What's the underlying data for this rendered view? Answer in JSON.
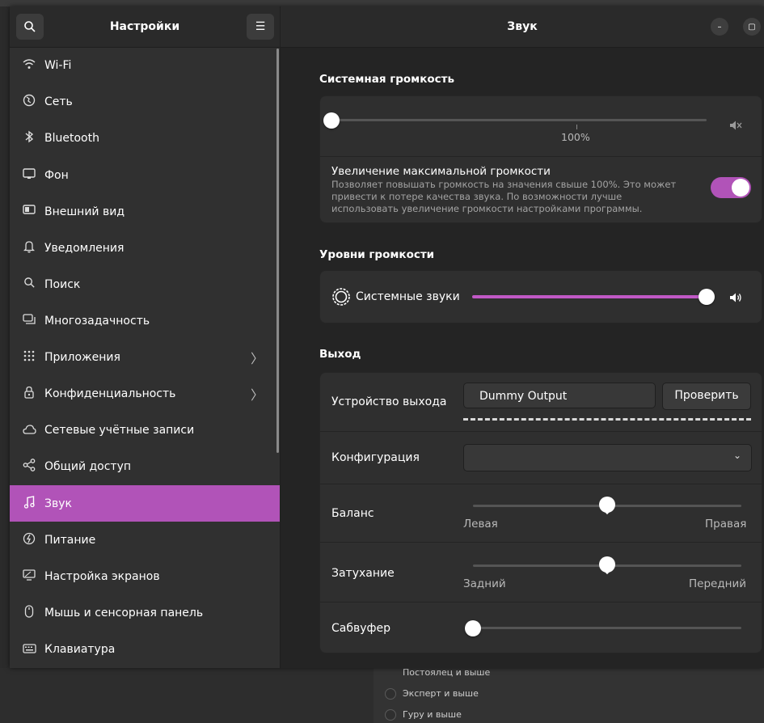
{
  "sidebar": {
    "title": "Настройки",
    "items": [
      {
        "label": "Wi-Fi",
        "icon": "wifi-icon",
        "chevron": false,
        "active": false
      },
      {
        "label": "Сеть",
        "icon": "network-globe-icon",
        "chevron": false,
        "active": false
      },
      {
        "label": "Bluetooth",
        "icon": "bluetooth-icon",
        "chevron": false,
        "active": false
      },
      {
        "label": "Фон",
        "icon": "background-icon",
        "chevron": false,
        "active": false
      },
      {
        "label": "Внешний вид",
        "icon": "appearance-icon",
        "chevron": false,
        "active": false
      },
      {
        "label": "Уведомления",
        "icon": "bell-icon",
        "chevron": false,
        "active": false
      },
      {
        "label": "Поиск",
        "icon": "search-icon",
        "chevron": false,
        "active": false
      },
      {
        "label": "Многозадачность",
        "icon": "multitasking-icon",
        "chevron": false,
        "active": false
      },
      {
        "label": "Приложения",
        "icon": "apps-grid-icon",
        "chevron": true,
        "active": false
      },
      {
        "label": "Конфиденциальность",
        "icon": "lock-icon",
        "chevron": true,
        "active": false
      },
      {
        "label": "Сетевые учётные записи",
        "icon": "cloud-icon",
        "chevron": false,
        "active": false
      },
      {
        "label": "Общий доступ",
        "icon": "share-icon",
        "chevron": false,
        "active": false
      },
      {
        "label": "Звук",
        "icon": "music-note-icon",
        "chevron": false,
        "active": true
      },
      {
        "label": "Питание",
        "icon": "power-icon",
        "chevron": false,
        "active": false
      },
      {
        "label": "Настройка экранов",
        "icon": "display-icon",
        "chevron": false,
        "active": false
      },
      {
        "label": "Мышь и сенсорная панель",
        "icon": "mouse-icon",
        "chevron": false,
        "active": false
      },
      {
        "label": "Клавиатура",
        "icon": "keyboard-icon",
        "chevron": false,
        "active": false
      }
    ]
  },
  "main": {
    "title": "Звук",
    "system_volume": {
      "heading": "Системная громкость",
      "level": 0,
      "tick_label": "100%",
      "boost": {
        "label": "Увеличение максимальной громкости",
        "description": "Позволяет повышать громкость на значения свыше 100%. Это может привести к потере качества звука. По возможности лучше использовать увеличение громкости настройками программы.",
        "enabled": true
      }
    },
    "volume_levels": {
      "heading": "Уровни громкости",
      "system_sounds_label": "Системные звуки",
      "system_sounds_level": 1.0
    },
    "output": {
      "heading": "Выход",
      "device_label": "Устройство выхода",
      "device_value": "Dummy Output",
      "test_button": "Проверить",
      "config_label": "Конфигурация",
      "config_value": "",
      "balance_label": "Баланс",
      "balance_left": "Левая",
      "balance_right": "Правая",
      "balance_value": 0.5,
      "fade_label": "Затухание",
      "fade_left": "Задний",
      "fade_right": "Передний",
      "fade_value": 0.5,
      "subwoofer_label": "Сабвуфер",
      "subwoofer_value": 0
    }
  },
  "background_app": {
    "options": [
      "Постоялец и выше",
      "Эксперт и выше",
      "Гуру и выше"
    ]
  },
  "colors": {
    "accent": "#b153b8",
    "slider_fill": "#c159c6"
  }
}
